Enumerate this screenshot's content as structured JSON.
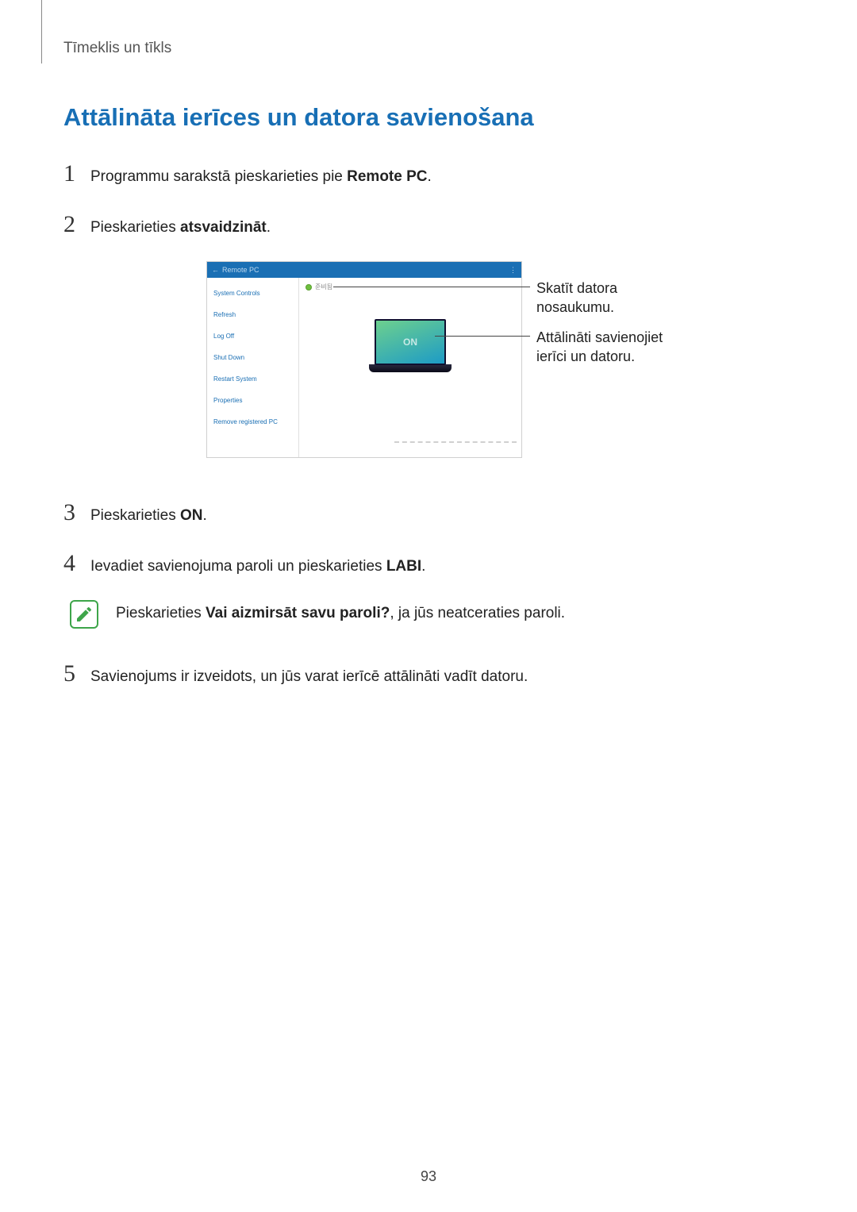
{
  "breadcrumb": "Tīmeklis un tīkls",
  "section_title": "Attālināta ierīces un datora savienošana",
  "steps": {
    "s1": {
      "num": "1",
      "pre": "Programmu sarakstā pieskarieties pie ",
      "bold": "Remote PC",
      "post": "."
    },
    "s2": {
      "num": "2",
      "pre": "Pieskarieties ",
      "bold": "atsvaidzināt",
      "post": "."
    },
    "s3": {
      "num": "3",
      "pre": "Pieskarieties ",
      "bold": "ON",
      "post": "."
    },
    "s4": {
      "num": "4",
      "pre": "Ievadiet savienojuma paroli un pieskarieties ",
      "bold": "LABI",
      "post": "."
    },
    "s5": {
      "num": "5",
      "text": "Savienojums ir izveidots, un jūs varat ierīcē attālināti vadīt datoru."
    }
  },
  "note": {
    "pre": "Pieskarieties ",
    "bold": "Vai aizmirsāt savu paroli?",
    "post": ", ja jūs neatceraties paroli."
  },
  "figure": {
    "title": "Remote PC",
    "sidebar": {
      "i0": "System Controls",
      "i1": "Refresh",
      "i2": "Log Off",
      "i3": "Shut Down",
      "i4": "Restart System",
      "i5": "Properties",
      "i6": "Remove registered PC"
    },
    "computer_label": "준비됨",
    "on": "ON"
  },
  "callouts": {
    "c1a": "Skatīt datora",
    "c1b": "nosaukumu.",
    "c2a": "Attālināti savienojiet",
    "c2b": "ierīci un datoru."
  },
  "page_number": "93"
}
